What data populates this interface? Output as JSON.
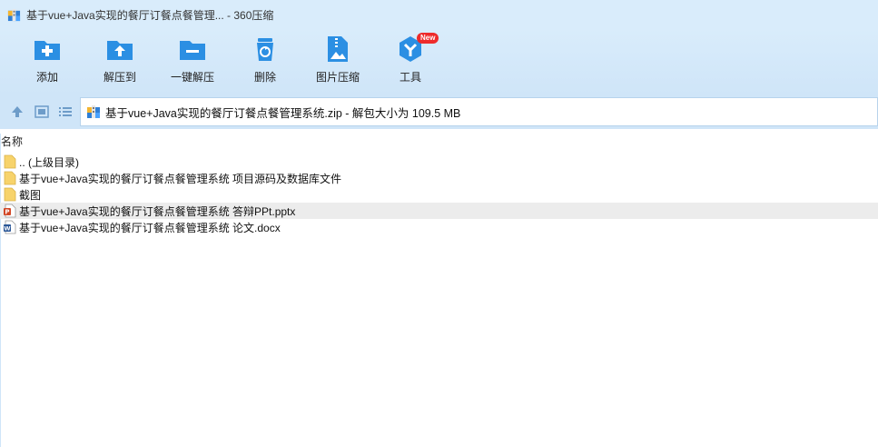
{
  "window": {
    "title": "基于vue+Java实现的餐厅订餐点餐管理... - 360压缩",
    "icon": "archive-icon"
  },
  "toolbar": {
    "items": [
      {
        "label": "添加",
        "icon": "add-icon"
      },
      {
        "label": "解压到",
        "icon": "extract-to-icon"
      },
      {
        "label": "一键解压",
        "icon": "one-click-extract-icon"
      },
      {
        "label": "删除",
        "icon": "delete-icon"
      },
      {
        "label": "图片压缩",
        "icon": "image-compress-icon"
      },
      {
        "label": "工具",
        "icon": "tools-icon",
        "badge": "New"
      }
    ]
  },
  "address": {
    "path": "基于vue+Java实现的餐厅订餐点餐管理系统.zip - 解包大小为 109.5 MB"
  },
  "list": {
    "column_name": "名称",
    "rows": [
      {
        "name": ".. (上级目录)",
        "type": "folder"
      },
      {
        "name": "基于vue+Java实现的餐厅订餐点餐管理系统 项目源码及数据库文件",
        "type": "folder"
      },
      {
        "name": "截图",
        "type": "folder"
      },
      {
        "name": "基于vue+Java实现的餐厅订餐点餐管理系统 答辩PPt.pptx",
        "type": "pptx",
        "highlighted": true
      },
      {
        "name": "基于vue+Java实现的餐厅订餐点餐管理系统 论文.docx",
        "type": "docx"
      }
    ]
  },
  "colors": {
    "toolbar_bg": "#d9ecfb",
    "accent_blue": "#2b8fe3",
    "badge_red": "#ee2b2b",
    "row_highlight": "#ececec"
  }
}
